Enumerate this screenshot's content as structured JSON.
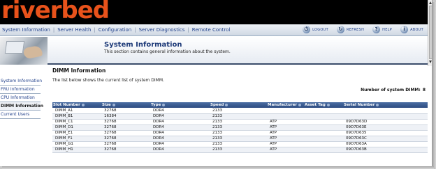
{
  "brand": {
    "logo_text": "riverbed",
    "logo_color": "#e8521b"
  },
  "nav": {
    "items": [
      "System Information",
      "Server Health",
      "Configuration",
      "Server Diagnostics",
      "Remote Control"
    ],
    "utilities": [
      {
        "label": "LOGOUT",
        "icon": "logout-icon"
      },
      {
        "label": "REFRESH",
        "icon": "refresh-icon"
      },
      {
        "label": "HELP",
        "icon": "help-icon"
      },
      {
        "label": "ABOUT",
        "icon": "about-icon"
      }
    ]
  },
  "header": {
    "title": "System Information",
    "description": "This section contains general information about the system."
  },
  "sidebar": {
    "items": [
      {
        "label": "System Information",
        "active": false
      },
      {
        "label": "FRU Information",
        "active": false
      },
      {
        "label": "CPU Information",
        "active": false
      },
      {
        "label": "DIMM Information",
        "active": true
      },
      {
        "label": "Current Users",
        "active": false
      }
    ]
  },
  "main": {
    "section_title": "DIMM Information",
    "section_desc": "The list below shows the current list of system DIMM.",
    "count_label": "Number of system DIMM:",
    "count_value": "8",
    "table": {
      "columns": [
        "Slot Number",
        "Size",
        "Type",
        "Speed",
        "Manufacturer",
        "Asset Tag",
        "Serial Number"
      ],
      "rows": [
        [
          "DIMM_A1",
          "32768",
          "DDR4",
          "2133",
          "",
          "",
          ""
        ],
        [
          "DIMM_B1",
          "16384",
          "DDR4",
          "2133",
          "",
          "",
          ""
        ],
        [
          "DIMM_C1",
          "32768",
          "DDR4",
          "2133",
          "ATP",
          "",
          "09D7D63D"
        ],
        [
          "DIMM_D1",
          "32768",
          "DDR4",
          "2133",
          "ATP",
          "",
          "09D7D63E"
        ],
        [
          "DIMM_E1",
          "32768",
          "DDR4",
          "2133",
          "ATP",
          "",
          "09D7D635"
        ],
        [
          "DIMM_F1",
          "32768",
          "DDR4",
          "2133",
          "ATP",
          "",
          "09D7D63C"
        ],
        [
          "DIMM_G1",
          "32768",
          "DDR4",
          "2133",
          "ATP",
          "",
          "09D7D63A"
        ],
        [
          "DIMM_H1",
          "32768",
          "DDR4",
          "2133",
          "ATP",
          "",
          "09D7D63B"
        ]
      ]
    }
  }
}
